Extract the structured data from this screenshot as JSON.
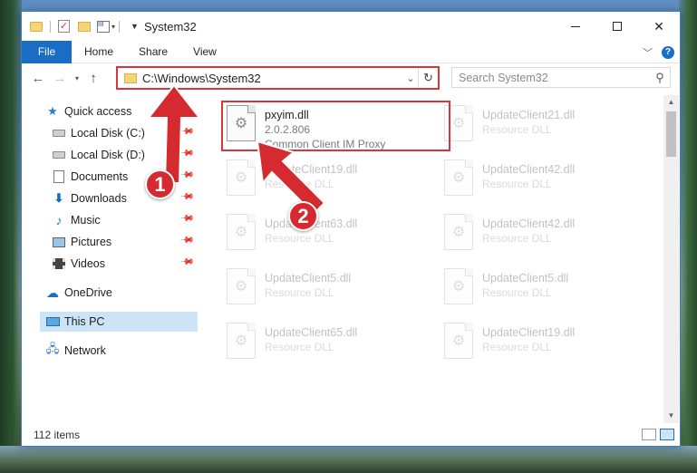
{
  "window": {
    "title": "System32"
  },
  "ribbon": {
    "tabs": [
      "File",
      "Home",
      "Share",
      "View"
    ]
  },
  "address": {
    "path": "C:\\Windows\\System32"
  },
  "search": {
    "placeholder": "Search System32"
  },
  "sidebar": {
    "items": [
      {
        "label": "Quick access",
        "icon": "star-icon"
      },
      {
        "label": "Local Disk (C:)",
        "icon": "drive-icon"
      },
      {
        "label": "Local Disk (D:)",
        "icon": "drive-icon"
      },
      {
        "label": "Documents",
        "icon": "documents-icon"
      },
      {
        "label": "Downloads",
        "icon": "downloads-icon"
      },
      {
        "label": "Music",
        "icon": "music-icon"
      },
      {
        "label": "Pictures",
        "icon": "pictures-icon"
      },
      {
        "label": "Videos",
        "icon": "videos-icon"
      },
      {
        "label": "OneDrive",
        "icon": "cloud-icon"
      },
      {
        "label": "This PC",
        "icon": "pc-icon",
        "selected": true
      },
      {
        "label": "Network",
        "icon": "network-icon"
      }
    ]
  },
  "files": [
    {
      "name": "pxyim.dll",
      "version": "2.0.2.806",
      "description": "Common Client IM Proxy"
    },
    {
      "name": "UpdateClient21.dll",
      "description": "Resource DLL"
    },
    {
      "name": "UpdateClient19.dll",
      "description": "Resource DLL"
    },
    {
      "name": "UpdateClient42.dll",
      "description": "Resource DLL"
    },
    {
      "name": "UpdateClient63.dll",
      "description": "Resource DLL"
    },
    {
      "name": "UpdateClient42.dll",
      "description": "Resource DLL"
    },
    {
      "name": "UpdateClient5.dll",
      "description": "Resource DLL"
    },
    {
      "name": "UpdateClient5.dll",
      "description": "Resource DLL"
    },
    {
      "name": "UpdateClient65.dll",
      "description": "Resource DLL"
    },
    {
      "name": "UpdateClient19.dll",
      "description": "Resource DLL"
    }
  ],
  "status": {
    "item_count": "112 items"
  },
  "callouts": {
    "step1": "1",
    "step2": "2",
    "color": "#d52a2f"
  }
}
